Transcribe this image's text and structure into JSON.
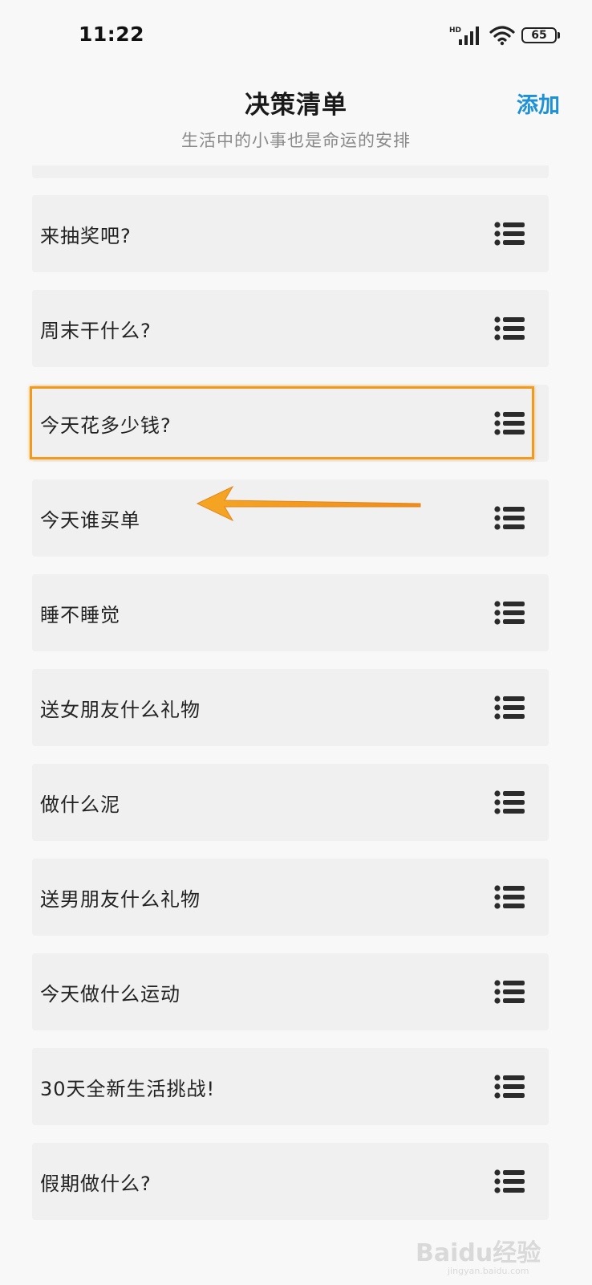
{
  "status_bar": {
    "time": "11:22",
    "network_label": "HD",
    "battery_level": "65"
  },
  "header": {
    "title": "决策清单",
    "subtitle": "生活中的小事也是命运的安排",
    "add_label": "添加"
  },
  "list": {
    "items": [
      {
        "label": "来抽奖吧?"
      },
      {
        "label": "周末干什么?"
      },
      {
        "label": "今天花多少钱?"
      },
      {
        "label": "今天谁买单"
      },
      {
        "label": "睡不睡觉"
      },
      {
        "label": "送女朋友什么礼物"
      },
      {
        "label": "做什么泥"
      },
      {
        "label": "送男朋友什么礼物"
      },
      {
        "label": "今天做什么运动"
      },
      {
        "label": "30天全新生活挑战!"
      },
      {
        "label": "假期做什么?"
      }
    ],
    "item_icon": "list-menu-icon"
  },
  "annotation": {
    "highlighted_item_index": 2,
    "color": "#f29a1e"
  },
  "watermark": {
    "text": "Baidu经验",
    "sub": "jingyan.baidu.com"
  },
  "colors": {
    "accent": "#1e90d6",
    "background": "#f8f8f8",
    "item_background": "#f0f0f0"
  }
}
